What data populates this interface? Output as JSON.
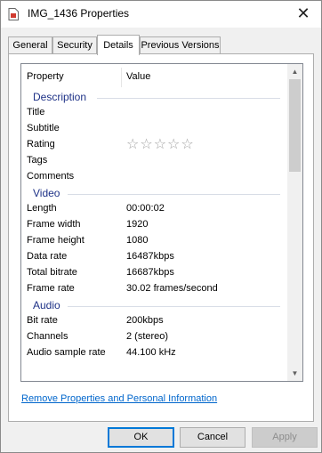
{
  "window": {
    "title": "IMG_1436 Properties"
  },
  "tabs": [
    {
      "label": "General"
    },
    {
      "label": "Security"
    },
    {
      "label": "Details"
    },
    {
      "label": "Previous Versions"
    }
  ],
  "active_tab": "Details",
  "columns": {
    "property": "Property",
    "value": "Value"
  },
  "groups": {
    "description": "Description",
    "video": "Video",
    "audio": "Audio"
  },
  "description_rows": [
    {
      "key": "Title",
      "value": ""
    },
    {
      "key": "Subtitle",
      "value": ""
    },
    {
      "key": "Rating",
      "value": ""
    },
    {
      "key": "Tags",
      "value": ""
    },
    {
      "key": "Comments",
      "value": ""
    }
  ],
  "rating": {
    "stars_filled": 0,
    "stars_total": 5,
    "glyphs": "☆☆☆☆☆"
  },
  "video_rows": [
    {
      "key": "Length",
      "value": "00:00:02"
    },
    {
      "key": "Frame width",
      "value": "1920"
    },
    {
      "key": "Frame height",
      "value": "1080"
    },
    {
      "key": "Data rate",
      "value": "16487kbps"
    },
    {
      "key": "Total bitrate",
      "value": "16687kbps"
    },
    {
      "key": "Frame rate",
      "value": "30.02 frames/second"
    }
  ],
  "audio_rows": [
    {
      "key": "Bit rate",
      "value": "200kbps"
    },
    {
      "key": "Channels",
      "value": "2 (stereo)"
    },
    {
      "key": "Audio sample rate",
      "value": "44.100 kHz"
    }
  ],
  "remove_link": "Remove Properties and Personal Information",
  "buttons": {
    "ok": "OK",
    "cancel": "Cancel",
    "apply": "Apply"
  },
  "icons": {
    "close": "✕",
    "scroll_up": "▲",
    "scroll_down": "▼"
  },
  "colors": {
    "group_header": "#1e3287",
    "link": "#0066cc",
    "focus_border": "#0078d7"
  }
}
